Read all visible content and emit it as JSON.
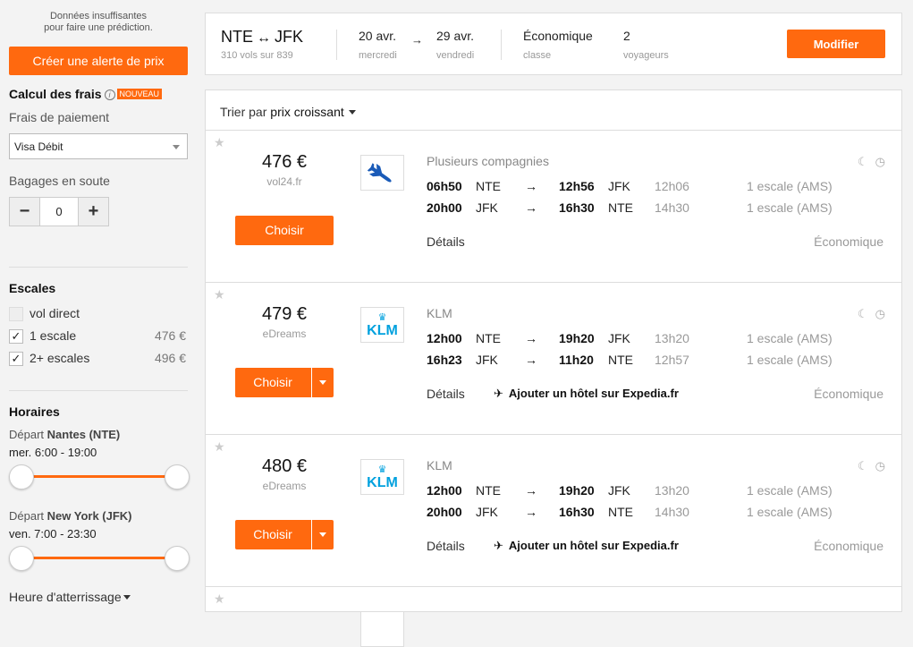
{
  "sidebar": {
    "prediction_text_1": "Données insuffisantes",
    "prediction_text_2": "pour faire une prédiction.",
    "alert_button": "Créer une alerte de prix",
    "fees_title": "Calcul des frais",
    "fees_info": "i",
    "fees_badge": "NOUVEAU",
    "payment_label": "Frais de paiement",
    "payment_value": "Visa Débit",
    "bags_label": "Bagages en soute",
    "bags_minus": "−",
    "bags_value": "0",
    "bags_plus": "+",
    "stops_title": "Escales",
    "stops": [
      {
        "label": "vol direct",
        "checked": false,
        "disabled": true,
        "price": ""
      },
      {
        "label": "1 escale",
        "checked": true,
        "disabled": false,
        "price": "476 €"
      },
      {
        "label": "2+ escales",
        "checked": true,
        "disabled": false,
        "price": "496 €"
      }
    ],
    "check_mark": "✓",
    "times_title": "Horaires",
    "depart1_prefix": "Départ ",
    "depart1_city": "Nantes (NTE)",
    "depart1_range": "mer. 6:00 - 19:00",
    "depart2_prefix": "Départ ",
    "depart2_city": "New York (JFK)",
    "depart2_range": "ven. 7:00 - 23:30",
    "landing_label": "Heure d'atterrissage"
  },
  "summary": {
    "origin": "NTE",
    "swap": "↔",
    "destination": "JFK",
    "flights_count": "310 vols sur 839",
    "date_out": "20 avr.",
    "date_out_day": "mercredi",
    "date_arrow": "→",
    "date_back": "29 avr.",
    "date_back_day": "vendredi",
    "cabin": "Économique",
    "cabin_sub": "classe",
    "travelers": "2",
    "travelers_sub": "voyageurs",
    "modify_button": "Modifier"
  },
  "sort": {
    "prefix": "Trier par ",
    "value": "prix croissant"
  },
  "results": [
    {
      "price": "476 €",
      "provider": "vol24.fr",
      "choose": "Choisir",
      "split_button": false,
      "airline": "Plusieurs compagnies",
      "logo": "plane",
      "legs": [
        {
          "dep": "06h50",
          "from": "NTE",
          "arr": "12h56",
          "to": "JFK",
          "dur": "12h06",
          "stops": "1 escale (AMS)"
        },
        {
          "dep": "20h00",
          "from": "JFK",
          "arr": "16h30",
          "to": "NTE",
          "dur": "14h30",
          "stops": "1 escale (AMS)"
        }
      ],
      "details": "Détails",
      "hotel": "",
      "cabin": "Économique"
    },
    {
      "price": "479 €",
      "provider": "eDreams",
      "choose": "Choisir",
      "split_button": true,
      "airline": "KLM",
      "logo": "klm",
      "legs": [
        {
          "dep": "12h00",
          "from": "NTE",
          "arr": "19h20",
          "to": "JFK",
          "dur": "13h20",
          "stops": "1 escale (AMS)"
        },
        {
          "dep": "16h23",
          "from": "JFK",
          "arr": "11h20",
          "to": "NTE",
          "dur": "12h57",
          "stops": "1 escale (AMS)"
        }
      ],
      "details": "Détails",
      "hotel": "Ajouter un hôtel sur Expedia.fr",
      "cabin": "Économique"
    },
    {
      "price": "480 €",
      "provider": "eDreams",
      "choose": "Choisir",
      "split_button": true,
      "airline": "KLM",
      "logo": "klm",
      "legs": [
        {
          "dep": "12h00",
          "from": "NTE",
          "arr": "19h20",
          "to": "JFK",
          "dur": "13h20",
          "stops": "1 escale (AMS)"
        },
        {
          "dep": "20h00",
          "from": "JFK",
          "arr": "16h30",
          "to": "NTE",
          "dur": "14h30",
          "stops": "1 escale (AMS)"
        }
      ],
      "details": "Détails",
      "hotel": "Ajouter un hôtel sur Expedia.fr",
      "cabin": "Économique"
    }
  ],
  "glyphs": {
    "star": "★",
    "moon": "☾",
    "clock": "◷",
    "leg_arrow": "→",
    "klm_text": "KLM",
    "klm_crown": "♛"
  },
  "colors": {
    "accent": "#ff690f",
    "plane_blue": "#1a5bb8",
    "klm_blue": "#00a1de"
  }
}
